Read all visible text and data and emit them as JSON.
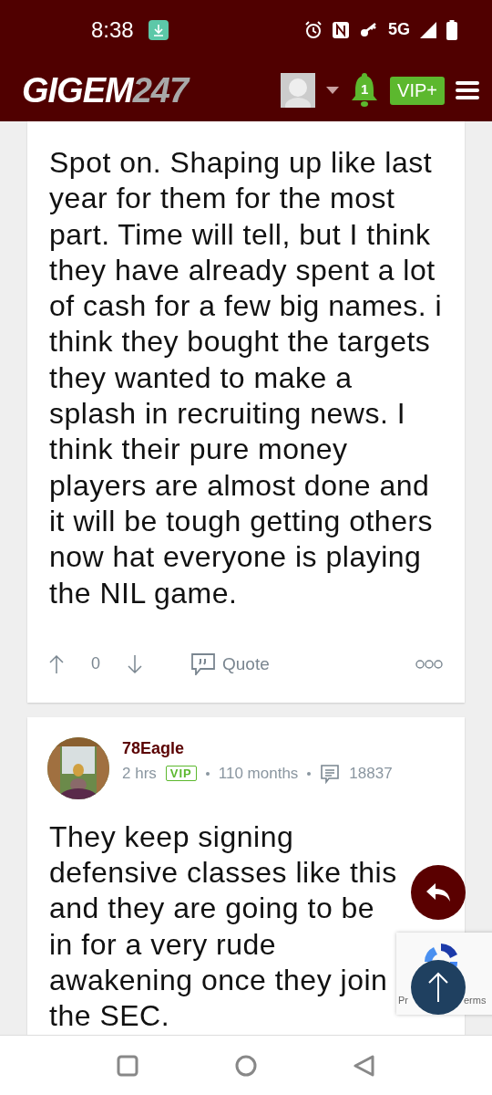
{
  "status_bar": {
    "time": "8:38",
    "network": "5G"
  },
  "header": {
    "logo": "GIGEM",
    "logo_suffix": "247",
    "notifications": "1",
    "vip_button": "VIP+"
  },
  "posts": [
    {
      "text": "Spot on. Shaping up like last year for them for the most part. Time will tell, but I think they have already spent a lot of cash for a few big names. i think they bought the targets they wanted to make a splash in recruiting news. I think their pure money players are almost done and it will be tough getting others now hat everyone is playing the NIL game.",
      "votes": "0",
      "quote": "Quote"
    },
    {
      "author": "78Eagle",
      "time": "2 hrs",
      "badge": "VIP",
      "tenure": "110 months",
      "post_count": "18837",
      "text": "They keep signing defensive classes like this and they are going to be in for a very rude awakening once they join the SEC."
    }
  ],
  "recaptcha": {
    "left": "Pr",
    "right": "erms"
  }
}
